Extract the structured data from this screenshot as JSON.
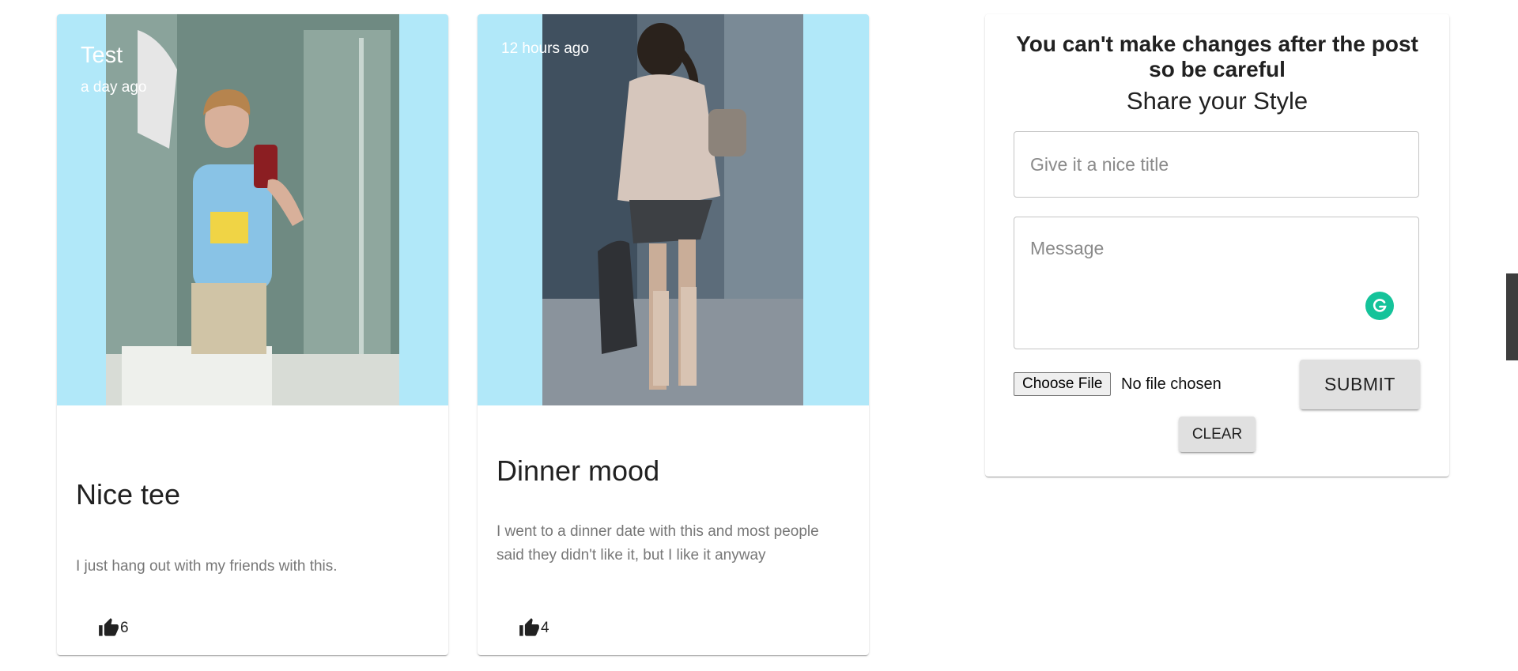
{
  "posts": [
    {
      "overlay_title": "Test",
      "time": "a day ago",
      "title": "Nice tee",
      "message": "I just hang out with my friends with this.",
      "likes": "6"
    },
    {
      "overlay_title": "",
      "time": "12 hours ago",
      "title": "Dinner mood",
      "message": "I went to a dinner date with this and most people said they didn't like it, but I like it anyway",
      "likes": "4"
    }
  ],
  "form": {
    "warning": "You can't make changes after the post so be careful",
    "heading": "Share your Style",
    "title_placeholder": "Give it a nice title",
    "message_placeholder": "Message",
    "choose_file_label": "Choose File",
    "no_file_text": "No file chosen",
    "submit_label": "SUBMIT",
    "clear_label": "CLEAR"
  },
  "colors": {
    "media_background": "#b1e8f9",
    "button_background": "#e0e0e0",
    "grammarly": "#15c39a"
  },
  "icons": {
    "like": "thumb-up-icon",
    "grammarly": "grammarly-icon"
  }
}
